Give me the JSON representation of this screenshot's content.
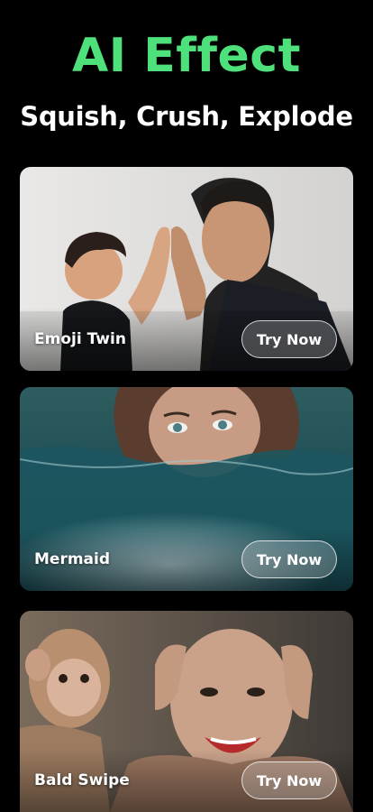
{
  "header": {
    "title": "AI Effect",
    "subtitle": "Squish, Crush, Explode"
  },
  "effects": [
    {
      "label": "Emoji Twin",
      "button": "Try Now"
    },
    {
      "label": "Mermaid",
      "button": "Try Now"
    },
    {
      "label": "Bald Swipe",
      "button": "Try Now"
    }
  ],
  "colors": {
    "background": "#000000",
    "title": "#4ee07a",
    "button_border": "#ffffff"
  }
}
